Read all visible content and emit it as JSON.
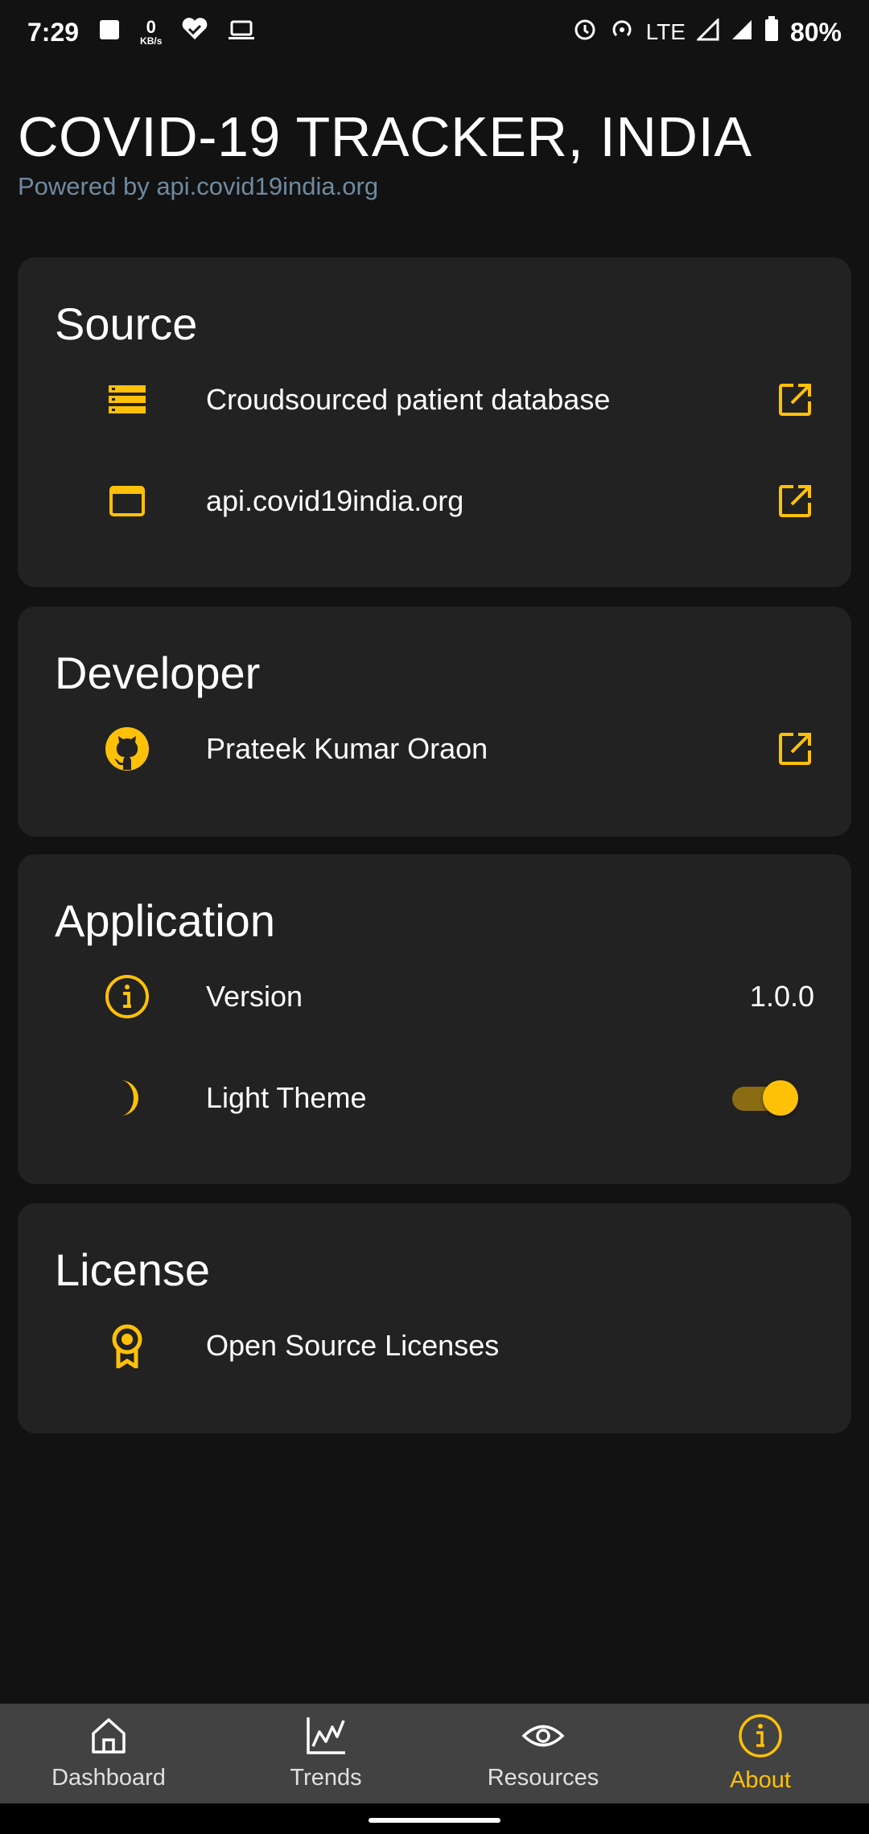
{
  "status_bar": {
    "time": "7:29",
    "net_speed": "0",
    "net_unit": "KB/s",
    "network": "LTE",
    "battery": "80%"
  },
  "header": {
    "title": "COVID-19 TRACKER, INDIA",
    "subtitle": "Powered by api.covid19india.org"
  },
  "sections": {
    "source": {
      "title": "Source",
      "items": [
        {
          "label": "Croudsourced patient database",
          "icon": "database-list-icon"
        },
        {
          "label": "api.covid19india.org",
          "icon": "browser-window-icon"
        }
      ]
    },
    "developer": {
      "title": "Developer",
      "items": [
        {
          "label": "Prateek Kumar Oraon",
          "icon": "github-icon"
        }
      ]
    },
    "application": {
      "title": "Application",
      "version_label": "Version",
      "version_value": "1.0.0",
      "theme_label": "Light Theme",
      "theme_toggle_on": true
    },
    "license": {
      "title": "License",
      "items": [
        {
          "label": "Open Source Licenses",
          "icon": "award-icon"
        }
      ]
    }
  },
  "bottom_nav": {
    "items": [
      {
        "label": "Dashboard",
        "icon": "home-icon"
      },
      {
        "label": "Trends",
        "icon": "trend-chart-icon"
      },
      {
        "label": "Resources",
        "icon": "eye-icon"
      },
      {
        "label": "About",
        "icon": "info-icon",
        "active": true
      }
    ]
  },
  "colors": {
    "accent": "#ffc107",
    "background": "#121212",
    "card": "#222222",
    "nav": "#424242",
    "subtitle": "#6f8aa0"
  }
}
